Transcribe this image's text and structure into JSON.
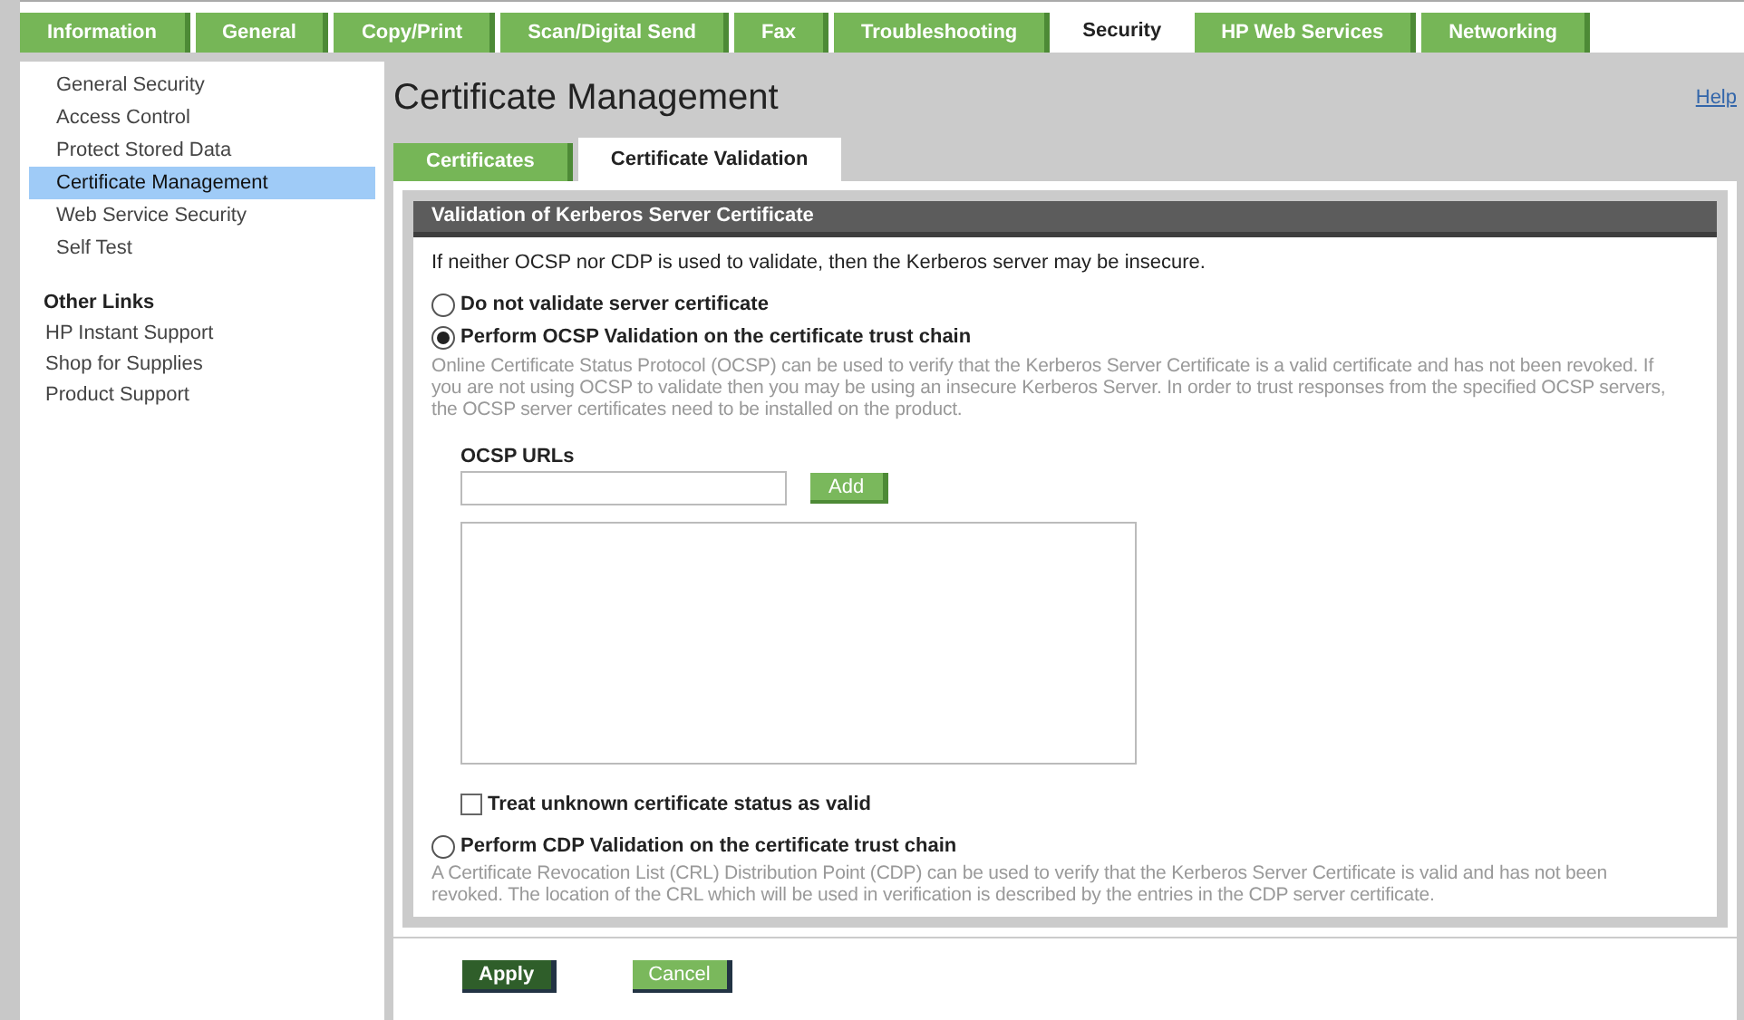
{
  "tabs": [
    {
      "label": "Information",
      "selected": false
    },
    {
      "label": "General",
      "selected": false
    },
    {
      "label": "Copy/Print",
      "selected": false
    },
    {
      "label": "Scan/Digital Send",
      "selected": false
    },
    {
      "label": "Fax",
      "selected": false
    },
    {
      "label": "Troubleshooting",
      "selected": false
    },
    {
      "label": "Security",
      "selected": true
    },
    {
      "label": "HP Web Services",
      "selected": false
    },
    {
      "label": "Networking",
      "selected": false
    }
  ],
  "sidebar": {
    "items": [
      {
        "label": "General Security",
        "selected": false
      },
      {
        "label": "Access Control",
        "selected": false
      },
      {
        "label": "Protect Stored Data",
        "selected": false
      },
      {
        "label": "Certificate Management",
        "selected": true
      },
      {
        "label": "Web Service Security",
        "selected": false
      },
      {
        "label": "Self Test",
        "selected": false
      }
    ],
    "other_links_title": "Other Links",
    "other_links": [
      "HP Instant Support",
      "Shop for Supplies",
      "Product Support"
    ]
  },
  "page_title": "Certificate Management",
  "help_link": "Help",
  "subtabs": [
    {
      "label": "Certificates",
      "selected": false
    },
    {
      "label": "Certificate Validation",
      "selected": true
    }
  ],
  "panel": {
    "title": "Validation of Kerberos Server Certificate",
    "intro": "If neither OCSP nor CDP is used to validate, then the Kerberos server may be insecure.",
    "options": [
      {
        "label": "Do not validate server certificate",
        "selected": false
      },
      {
        "label": "Perform OCSP Validation on the certificate trust chain",
        "selected": true,
        "description": "Online Certificate Status Protocol (OCSP) can be used to verify that the Kerberos Server Certificate is a valid certificate and has not been revoked. If you are not using OCSP to validate then you may be using an insecure Kerberos Server. In order to trust responses from the specified OCSP servers, the OCSP server certificates need to be installed on the product."
      },
      {
        "label": "Perform CDP Validation on the certificate trust chain",
        "selected": false,
        "description": "A Certificate Revocation List (CRL) Distribution Point (CDP) can be used to verify that the Kerberos Server Certificate is valid and has not been revoked. The location of the CRL which will be used in verification is described by the entries in the CDP server certificate."
      }
    ],
    "ocsp_label": "OCSP URLs",
    "add_button": "Add",
    "treat_unknown": {
      "label": "Treat unknown certificate status as valid",
      "checked": false
    }
  },
  "buttons": [
    {
      "label": "Apply",
      "kind": "primary"
    },
    {
      "label": "Cancel",
      "kind": "secondary"
    }
  ]
}
